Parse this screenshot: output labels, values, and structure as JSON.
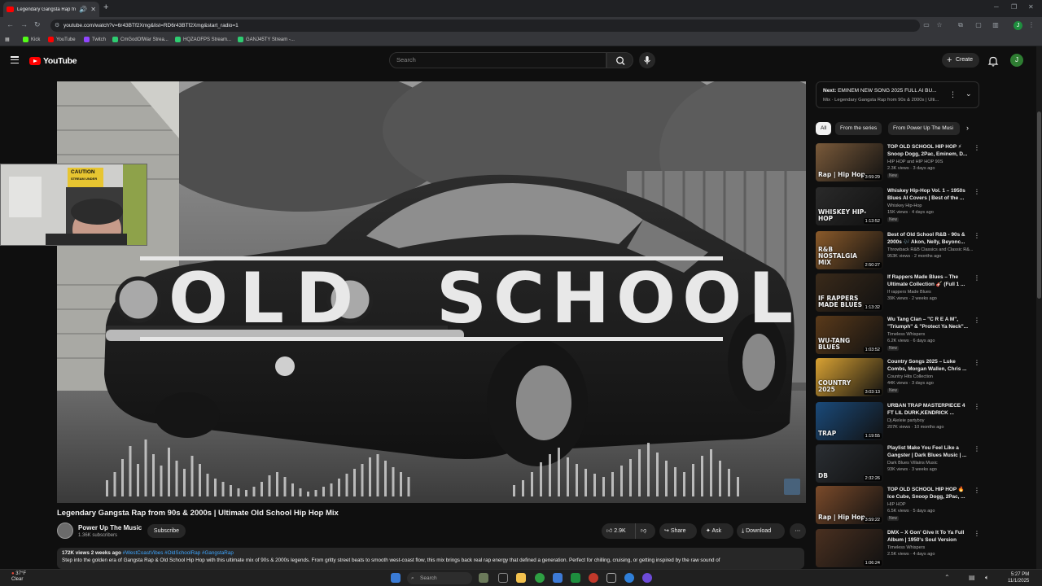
{
  "browser": {
    "tab_title": "Legendary Gangsta Rap fro...",
    "url": "youtube.com/watch?v=6r43BTf2Xmg&list=RD6r43BTf2Xmg&start_radio=1",
    "bookmarks": [
      {
        "label": "Kick",
        "color": "#53fc18"
      },
      {
        "label": "YouTube",
        "color": "#ff0000"
      },
      {
        "label": "Twitch",
        "color": "#9146ff"
      },
      {
        "label": "CmGodOfWar Strea...",
        "color": "#2ecc71"
      },
      {
        "label": "HQZAOFPS Stream...",
        "color": "#2ecc71"
      },
      {
        "label": "GANJ45TY Stream -...",
        "color": "#2ecc71"
      }
    ],
    "profile_initial": "J"
  },
  "youtube": {
    "logo_text": "YouTube",
    "search_placeholder": "Search",
    "create_label": "Create",
    "avatar_initial": "J"
  },
  "video": {
    "overlay_left": "OLD",
    "overlay_right": "SCHOOL",
    "title": "Legendary Gangsta Rap from 90s & 2000s | Ultimate Old School Hip Hop Mix",
    "channel": "Power Up The Music",
    "subscribers": "1.36K subscribers",
    "subscribe_label": "Subscribe",
    "likes": "2.9K",
    "share_label": "Share",
    "ask_label": "Ask",
    "download_label": "Download",
    "views_date": "172K views  2 weeks ago",
    "hashtags": "#WestCoastVibes #OldSchoolRap #GangstaRap",
    "description": "Step into the golden era of Gangsta Rap & Old School Hip Hop with this ultimate mix of 90s & 2000s legends. From gritty street beats to smooth west-coast flow, this mix brings back real rap energy that defined a generation. Perfect for chilling, cruising, or getting inspired by the raw sound of"
  },
  "webcam": {
    "sign_line1": "CAUTION",
    "sign_line2": "STREAM UNDER"
  },
  "sidebar": {
    "next_prefix": "Next:",
    "next_title": "EMINEM NEW SONG 2025 FULL AI BU...",
    "next_sub": "Mix · Legendary Gangsta Rap from 90s & 2000s | Ulti...",
    "chips": [
      "All",
      "From the series",
      "From Power Up The Musi"
    ],
    "new_badge": "New",
    "recs": [
      {
        "title": "TOP OLD SCHOOL HIP HOP ⚡ Snoop Dogg, 2Pac, Eminem, D...",
        "channel": "HIP HOP and HIP HOP 90S",
        "meta": "2.3K views · 3 days ago",
        "duration": "3:59:29",
        "thumb_text": "Rap | Hip Hop",
        "new": true,
        "bg": "#7a5a3a"
      },
      {
        "title": "Whiskey Hip-Hop Vol. 1 – 1950s Blues AI Covers | Best of the ...",
        "channel": "Whiskey Hip-Hop",
        "meta": "15K views · 4 days ago",
        "duration": "1:13:52",
        "thumb_text": "WHISKEY HIP-HOP",
        "new": true,
        "bg": "#2a2a2a"
      },
      {
        "title": "Best of Old School R&B - 90s & 2000s 🎶 Akon, Nelly, Beyonc...",
        "channel": "Throwback R&B Classics and Classic R&...",
        "meta": "953K views · 2 months ago",
        "duration": "2:50:27",
        "thumb_text": "R&B NOSTALGIA MIX",
        "new": false,
        "bg": "#8a5a2a"
      },
      {
        "title": "If Rappers Made Blues – The Ultimate Collection 🎸 (Full 1 ...",
        "channel": "If rappers Made Blues",
        "meta": "39K views · 2 weeks ago",
        "duration": "1:13:32",
        "thumb_text": "IF RAPPERS MADE BLUES",
        "new": false,
        "bg": "#3a2a1a"
      },
      {
        "title": "Wu Tang Clan – \"C R E A M\", \"Triumph\" & \"Protect Ya Neck\"...",
        "channel": "Timeless Whispers",
        "meta": "6.2K views · 6 days ago",
        "duration": "1:03:52",
        "thumb_text": "WU-TANG BLUES",
        "new": true,
        "bg": "#5a3a1a"
      },
      {
        "title": "Country Songs 2025 – Luke Combs, Morgan Wallen, Chris ...",
        "channel": "Country Hits Collection",
        "meta": "44K views · 3 days ago",
        "duration": "3:03:13",
        "thumb_text": "COUNTRY 2025",
        "new": true,
        "bg": "#d9a233"
      },
      {
        "title": "URBAN TRAP MASTERPIECE 4 FT LIL DURK,KENDRICK ...",
        "channel": "Dj Aleleie partyboy",
        "meta": "207K views · 10 months ago",
        "duration": "1:19:55",
        "thumb_text": "TRAP",
        "new": false,
        "bg": "#1a4a7a"
      },
      {
        "title": "Playlist Make You Feel Like a Gangster | Dark Blues Music | ...",
        "channel": "Dark Blues Villains Music",
        "meta": "93K views · 3 weeks ago",
        "duration": "2:32:26",
        "thumb_text": "DB",
        "new": false,
        "bg": "#2a2e33"
      },
      {
        "title": "TOP OLD SCHOOL HIP HOP 🔥 Ice Cube, Snoop Dogg, 2Pac, ...",
        "channel": "HIP HOP",
        "meta": "6.5K views · 5 days ago",
        "duration": "3:59:22",
        "thumb_text": "Rap | Hip Hop",
        "new": true,
        "bg": "#7a4a2a"
      },
      {
        "title": "DMX – X Gon' Give It To Ya Full Album | 1950's Soul Version",
        "channel": "Timeless Whispers",
        "meta": "2.5K views · 4 days ago",
        "duration": "1:06:24",
        "thumb_text": "",
        "new": false,
        "bg": "#4a3020"
      }
    ]
  },
  "taskbar": {
    "temp": "37°F",
    "weather": "Clear",
    "search_label": "Search",
    "time": "5:27 PM",
    "date": "11/1/2025"
  },
  "colors": {
    "yt_red": "#ff0000",
    "bg": "#0f0f0f",
    "link_blue": "#3ea6ff"
  }
}
